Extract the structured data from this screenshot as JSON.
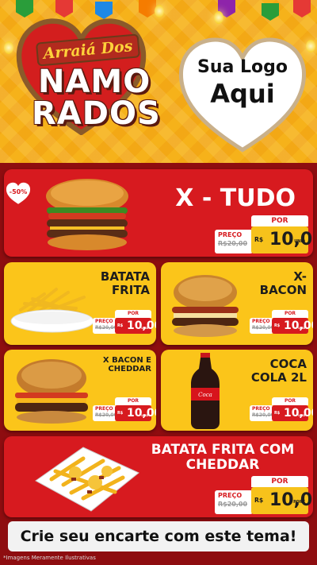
{
  "header": {
    "title_top": "Arraiá Dos",
    "title_line1": "NAMO",
    "title_line2": "RADOS",
    "logo_line1": "Sua Logo",
    "logo_line2": "Aqui"
  },
  "colors": {
    "red": "#d71a1f",
    "yellow": "#fbc51a",
    "dark_red": "#8e0d10"
  },
  "discount_badge": "-50%",
  "products": [
    {
      "name": "X - TUDO",
      "por": "POR",
      "preco_label": "PREÇO",
      "old_price": "R$20,00",
      "currency": "R$",
      "price": "10,00",
      "unit": "UNID",
      "icon": "burger-icon"
    },
    {
      "name": "BATATA FRITA",
      "por": "POR",
      "preco_label": "PREÇO",
      "old_price": "R$20,00",
      "currency": "R$",
      "price": "10,00",
      "unit": "UNID",
      "icon": "fries-icon"
    },
    {
      "name": "X- BACON",
      "por": "POR",
      "preco_label": "PREÇO",
      "old_price": "R$20,00",
      "currency": "R$",
      "price": "10,00",
      "unit": "UNID",
      "icon": "burger-icon"
    },
    {
      "name": "X BACON E CHEDDAR",
      "por": "POR",
      "preco_label": "PREÇO",
      "old_price": "R$20,00",
      "currency": "R$",
      "price": "10,00",
      "unit": "UNID",
      "icon": "burger-icon"
    },
    {
      "name": "COCA COLA 2L",
      "por": "POR",
      "preco_label": "PREÇO",
      "old_price": "R$20,00",
      "currency": "R$",
      "price": "10,00",
      "unit": "UNID",
      "icon": "soda-bottle-icon"
    },
    {
      "name": "BATATA FRITA COM CHEDDAR",
      "por": "POR",
      "preco_label": "PREÇO",
      "old_price": "R$20,00",
      "currency": "R$",
      "price": "10,00",
      "unit": "PORÇ",
      "icon": "fries-icon"
    }
  ],
  "cta": "Crie seu encarte com este tema!",
  "disclaimer": "*Imagens Meramente Ilustrativas"
}
